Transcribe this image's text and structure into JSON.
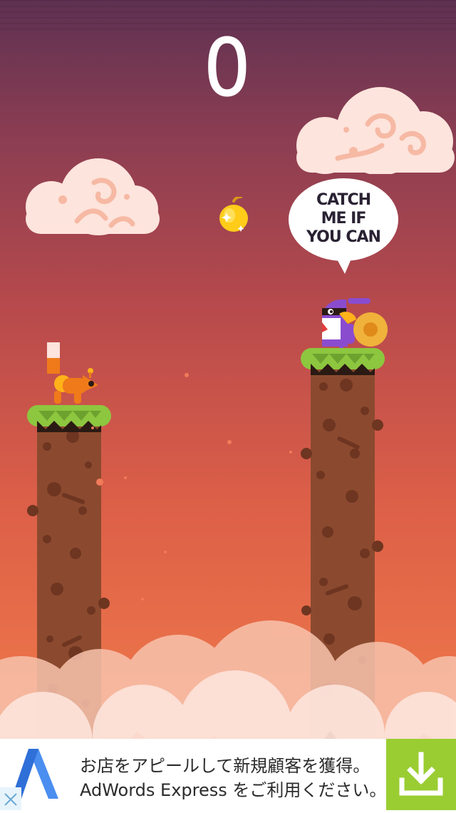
{
  "game": {
    "score": "0",
    "speech_bubble": "CATCH\nME IF\nYOU CAN"
  },
  "ad": {
    "line1": "お店をアピールして新規顧客を獲得。",
    "line2": "AdWords Express をご利用ください。"
  },
  "icons": {
    "ad_logo": "adwords-logo-icon",
    "download": "download-icon",
    "close": "close-icon",
    "apple": "golden-apple-icon"
  },
  "colors": {
    "sky_top": "#5e3152",
    "sky_bottom": "#f07a4a",
    "pillar": "#8b4a2f",
    "grass": "#8dc63f",
    "ad_accent": "#9acd32"
  }
}
